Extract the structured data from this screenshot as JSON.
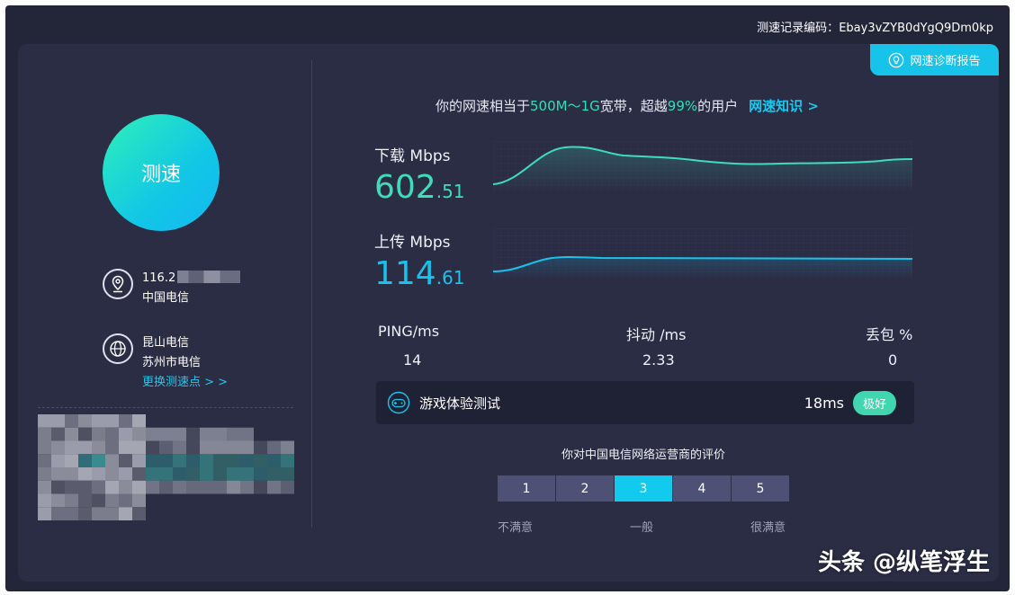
{
  "record": {
    "label": "测速记录编码：",
    "code": "Ebay3vZYB0dYgQ9Dm0kp"
  },
  "report_button": {
    "label": "网速诊断报告",
    "icon": "bulb-icon"
  },
  "speed_button": {
    "label": "测速"
  },
  "ip": {
    "prefix": "116.2",
    "isp": "中国电信"
  },
  "server": {
    "name": "昆山电信",
    "city": "苏州市电信",
    "change_label": "更换测速点 > >"
  },
  "summary": {
    "pre": "你的网速相当于",
    "range": "500M～1G",
    "mid": "宽带，超越",
    "percent": "99%",
    "post": "的用户",
    "knowledge": "网速知识 >"
  },
  "download": {
    "label": "下载 Mbps",
    "int": "602",
    "dec": ".51",
    "color": "#3fdcbc"
  },
  "upload": {
    "label": "上传 Mbps",
    "int": "114",
    "dec": ".61",
    "color": "#17c3ec"
  },
  "stats": [
    {
      "label": "PING/ms",
      "value": "14"
    },
    {
      "label": "抖动 /ms",
      "value": "2.33"
    },
    {
      "label": "丢包 %",
      "value": "0"
    }
  ],
  "game": {
    "title": "游戏体验测试",
    "ms": "18ms",
    "badge": "极好"
  },
  "rating": {
    "title": "你对中国电信网络运营商的评价",
    "options": [
      "1",
      "2",
      "3",
      "4",
      "5"
    ],
    "selected": "3",
    "low": "不满意",
    "mid": "一般",
    "high": "很满意"
  },
  "watermark": "头条 @纵笔浮生"
}
